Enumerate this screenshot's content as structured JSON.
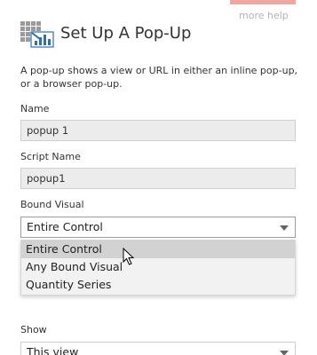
{
  "help": {
    "label": "more help"
  },
  "header": {
    "title": "Set Up A Pop-Up",
    "icon": "popup-chart-icon"
  },
  "description": "A pop-up shows a view or URL in either an inline pop-up, or a browser pop-up.",
  "fields": {
    "name": {
      "label": "Name",
      "value": "popup 1"
    },
    "script_name": {
      "label": "Script Name",
      "value": "popup1"
    },
    "bound_visual": {
      "label": "Bound Visual",
      "value": "Entire Control",
      "options": [
        "Entire Control",
        "Any Bound Visual",
        "Quantity Series"
      ],
      "hovered_option": "Entire Control"
    },
    "show": {
      "label": "Show",
      "value": "This view"
    }
  },
  "colors": {
    "accent_bar": "#f2a6a1",
    "icon_blue": "#2f6fb7",
    "hover": "#d2d2d2"
  }
}
